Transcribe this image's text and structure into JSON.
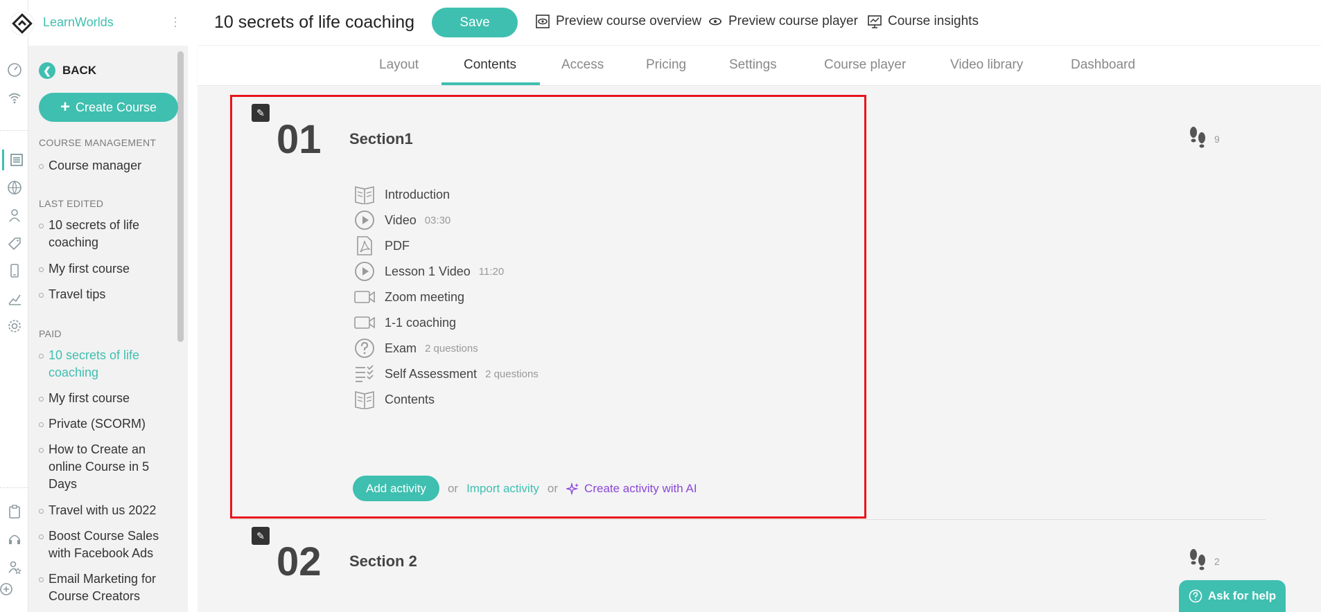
{
  "app": {
    "brand": "LearnWorlds",
    "accent": "#3fbfb0",
    "highlight": "#e8141a"
  },
  "rail_icons": [
    "speedometer-icon",
    "wifi-icon",
    "pages-icon",
    "globe-icon",
    "users-icon",
    "tag-icon",
    "mobile-icon",
    "chart-icon",
    "settings-icon",
    "clipboard-icon",
    "headset-icon",
    "people-star-icon",
    "plus-circle-icon"
  ],
  "sidebar": {
    "back_label": "BACK",
    "create_label": "Create Course",
    "groups": [
      {
        "title": "COURSE MANAGEMENT",
        "items": [
          "Course manager"
        ]
      },
      {
        "title": "LAST EDITED",
        "items": [
          "10 secrets of life coaching",
          "My first course",
          "Travel tips"
        ]
      },
      {
        "title": "PAID",
        "items": [
          "10 secrets of life coaching",
          "My first course",
          "Private (SCORM)",
          "How to Create an online Course in 5 Days",
          "Travel with us 2022",
          "Boost Course Sales with Facebook Ads",
          "Email Marketing for Course Creators"
        ]
      }
    ]
  },
  "header": {
    "course_title": "10 secrets of life coaching",
    "save_label": "Save",
    "links": [
      "Preview course overview",
      "Preview course player",
      "Course insights"
    ]
  },
  "tabs": [
    "Layout",
    "Contents",
    "Access",
    "Pricing",
    "Settings",
    "Course player",
    "Video library",
    "Dashboard"
  ],
  "active_tab": "Contents",
  "sections": [
    {
      "number": "01",
      "title": "Section1",
      "steps": "9",
      "activities": [
        {
          "icon": "book-icon",
          "label": "Introduction",
          "meta": ""
        },
        {
          "icon": "play-icon",
          "label": "Video",
          "meta": "03:30"
        },
        {
          "icon": "pdf-icon",
          "label": "PDF",
          "meta": ""
        },
        {
          "icon": "play-icon",
          "label": "Lesson 1 Video",
          "meta": "11:20"
        },
        {
          "icon": "camera-icon",
          "label": "Zoom meeting",
          "meta": ""
        },
        {
          "icon": "camera-icon",
          "label": "1-1 coaching",
          "meta": ""
        },
        {
          "icon": "question-icon",
          "label": "Exam",
          "meta": "2 questions"
        },
        {
          "icon": "checklist-icon",
          "label": "Self Assessment",
          "meta": "2 questions"
        },
        {
          "icon": "book-icon",
          "label": "Contents",
          "meta": ""
        }
      ],
      "add_label": "Add activity",
      "or_label": "or",
      "import_label": "Import activity",
      "ai_label": "Create activity with AI"
    },
    {
      "number": "02",
      "title": "Section 2",
      "steps": "2"
    }
  ],
  "help_label": "Ask for help"
}
